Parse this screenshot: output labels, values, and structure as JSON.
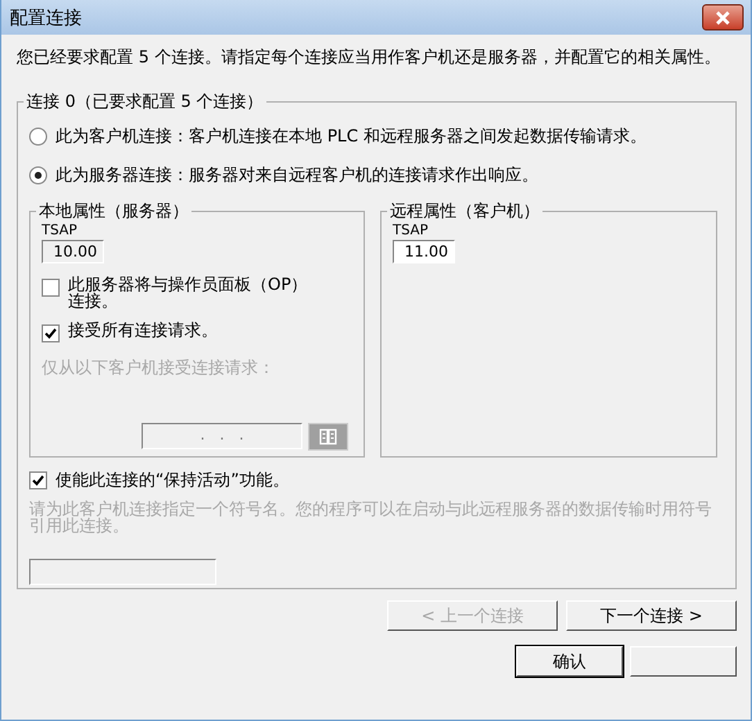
{
  "window": {
    "title": "配置连接"
  },
  "intro": "您已经要求配置 5 个连接。请指定每个连接应当用作客户机还是服务器，并配置它的相关属性。",
  "connection_group": {
    "title": "连接 0（已要求配置 5 个连接）",
    "roles": [
      {
        "label": "此为客户机连接：客户机连接在本地 PLC 和远程服务器之间发起数据传输请求。",
        "selected": false
      },
      {
        "label": "此为服务器连接：服务器对来自远程客户机的连接请求作出响应。",
        "selected": true
      }
    ],
    "local": {
      "title": "本地属性（服务器）",
      "tsap_label": "TSAP",
      "tsap": "10.00",
      "options": [
        {
          "label": "此服务器将与操作员面板（OP）连接。",
          "checked": false
        },
        {
          "label": "接受所有连接请求。",
          "checked": true
        }
      ],
      "restrict": {
        "label": "仅从以下客户机接受连接请求：",
        "disabled": true,
        "ip_value": ".   .   ."
      }
    },
    "remote": {
      "title": "远程属性（客户机）",
      "tsap_label": "TSAP",
      "tsap": "11.00"
    },
    "keep_alive": {
      "label": "使能此连接的“保持活动”功能。",
      "checked": true
    },
    "symbol": {
      "hint": "请为此客户机连接指定一个符号名。您的程序可以在启动与此远程服务器的数据传输时用符号引用此连接。",
      "disabled": true
    }
  },
  "nav_buttons": [
    {
      "label": "< 上一个连接",
      "disabled": true
    },
    {
      "label": "下一个连接 >",
      "disabled": false
    }
  ],
  "footer_buttons": [
    {
      "label": "确认",
      "default": true
    },
    {
      "default": false
    }
  ]
}
